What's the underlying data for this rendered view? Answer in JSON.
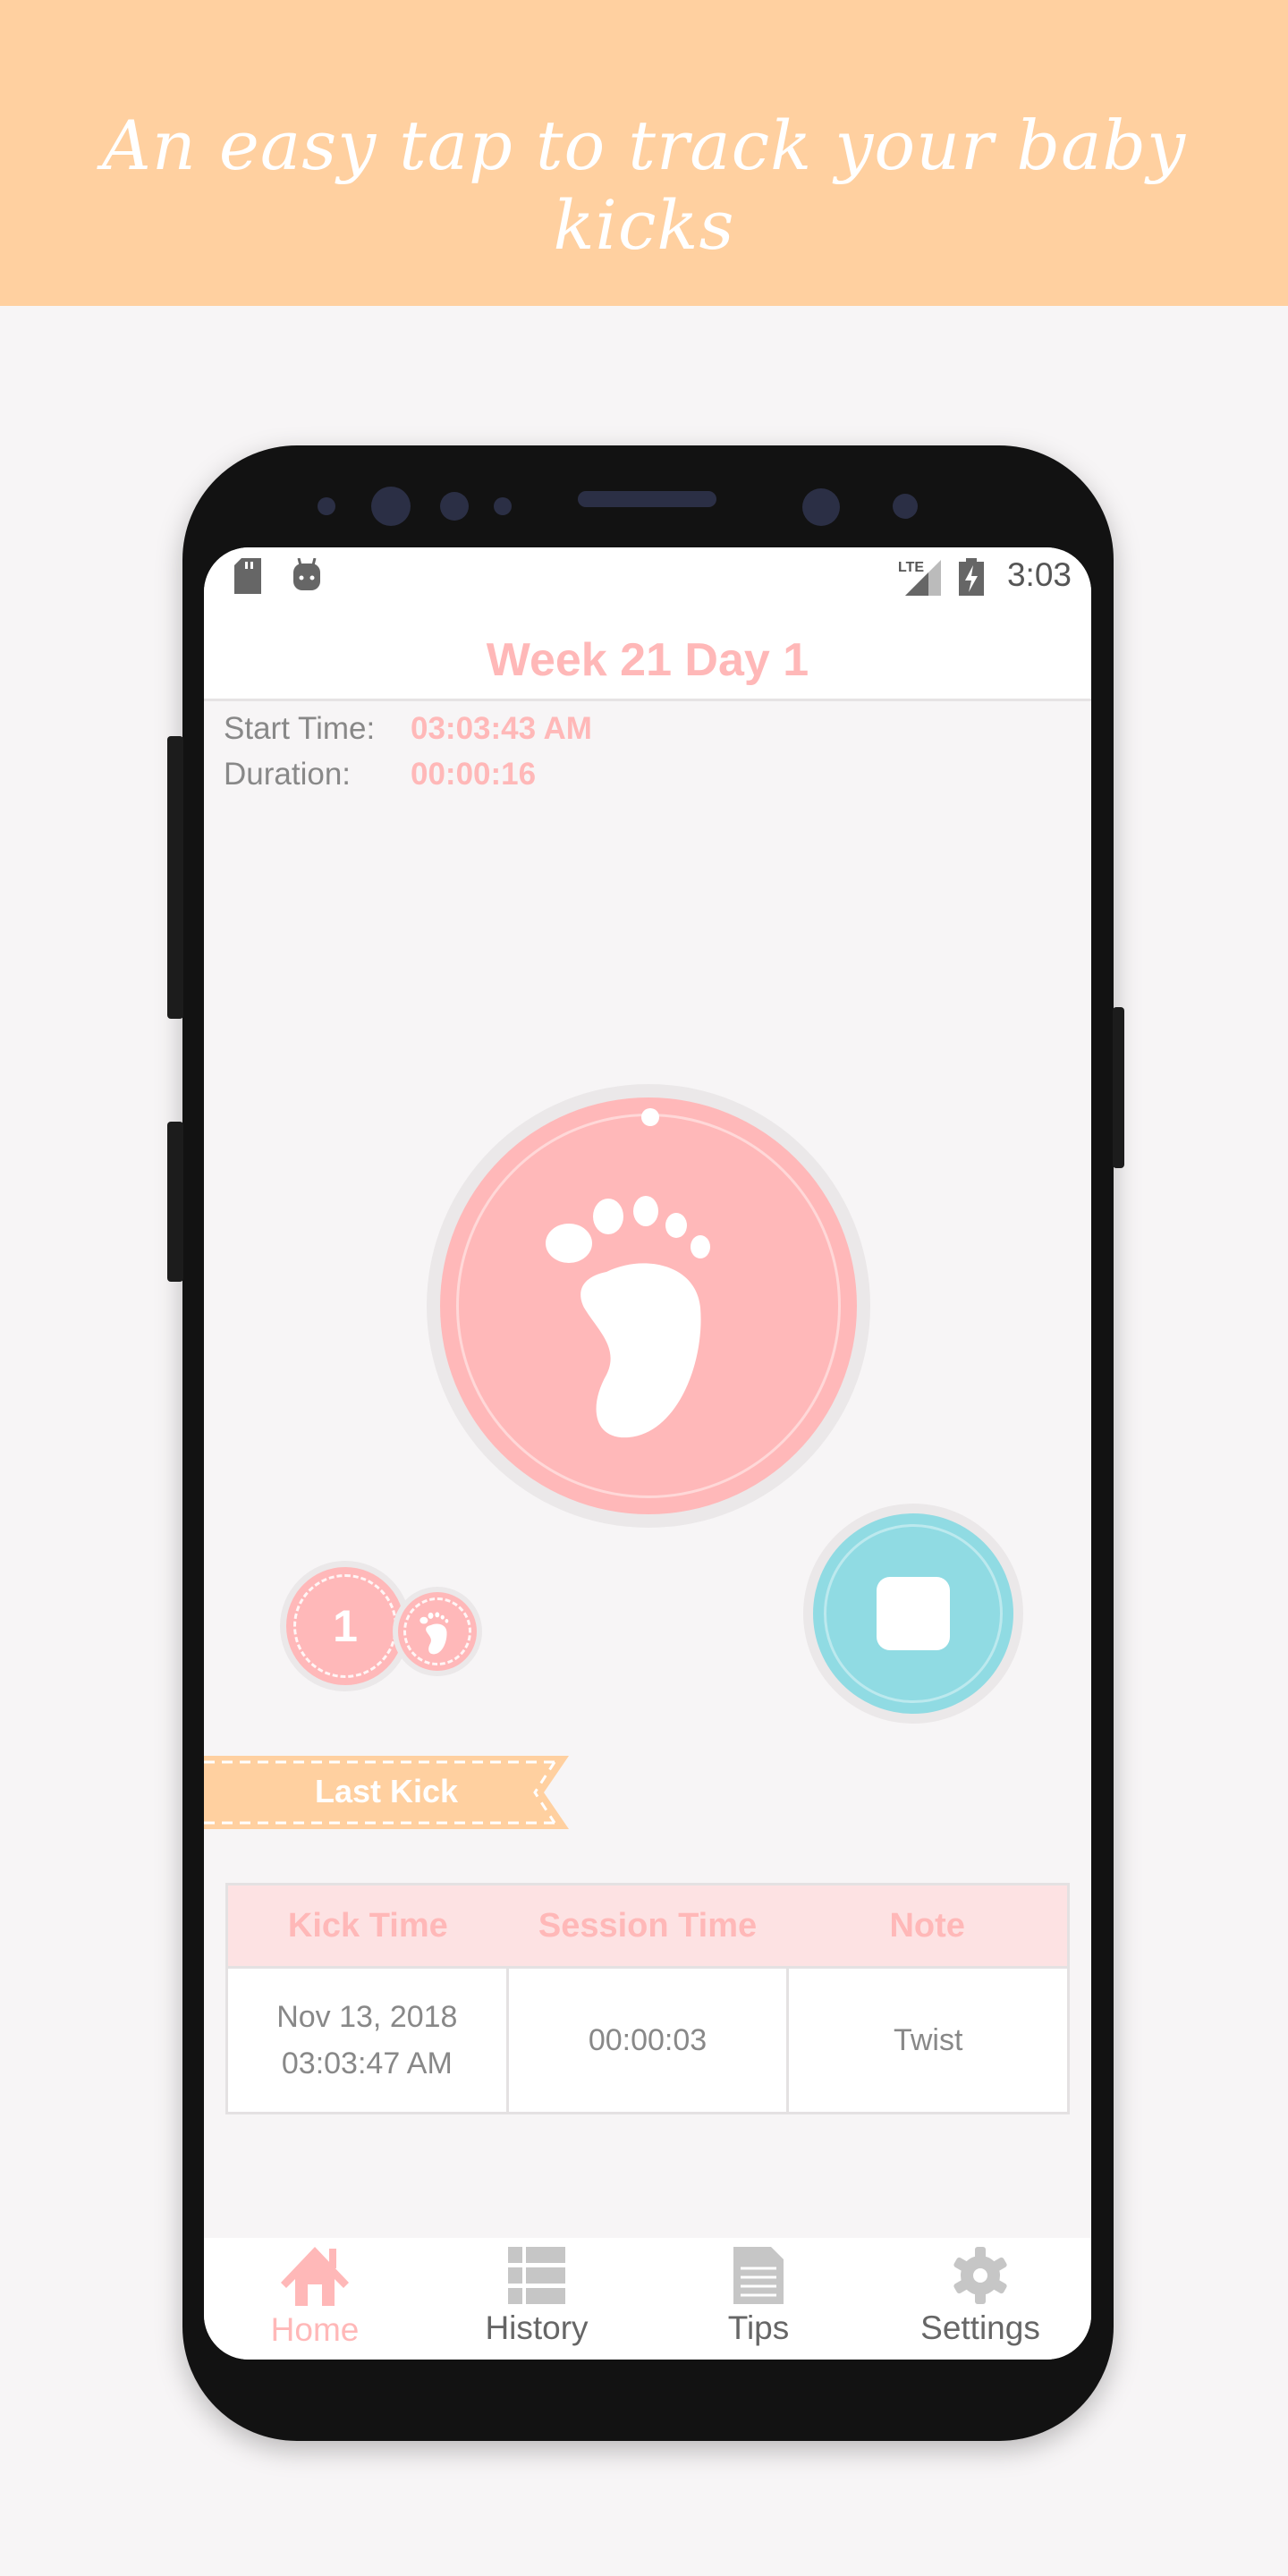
{
  "banner": {
    "tagline": "An easy tap to track your baby kicks",
    "color": "#ffd0a0"
  },
  "status_bar": {
    "time": "3:03",
    "network": "LTE",
    "icons": [
      "sd-card-icon",
      "android-icon",
      "signal-icon",
      "battery-charging-icon"
    ]
  },
  "header": {
    "title": "Week 21 Day 1"
  },
  "session": {
    "start_label": "Start Time:",
    "start_value": "03:03:43 AM",
    "duration_label": "Duration:",
    "duration_value": "00:00:16"
  },
  "counter": {
    "kick_count": "1"
  },
  "last_kick": {
    "ribbon_label": "Last Kick",
    "columns": [
      "Kick Time",
      "Session Time",
      "Note"
    ],
    "rows": [
      {
        "kick_date": "Nov 13, 2018",
        "kick_time": "03:03:47 AM",
        "session_time": "00:00:03",
        "note": "Twist"
      }
    ]
  },
  "nav": {
    "items": [
      {
        "label": "Home",
        "icon": "home-icon",
        "active": true
      },
      {
        "label": "History",
        "icon": "list-icon"
      },
      {
        "label": "Tips",
        "icon": "document-icon"
      },
      {
        "label": "Settings",
        "icon": "gear-icon"
      }
    ]
  },
  "colors": {
    "accent": "#ffb8b8",
    "stop": "#90dbe3",
    "ribbon": "#ffd0a0",
    "background": "#f7f5f6"
  }
}
